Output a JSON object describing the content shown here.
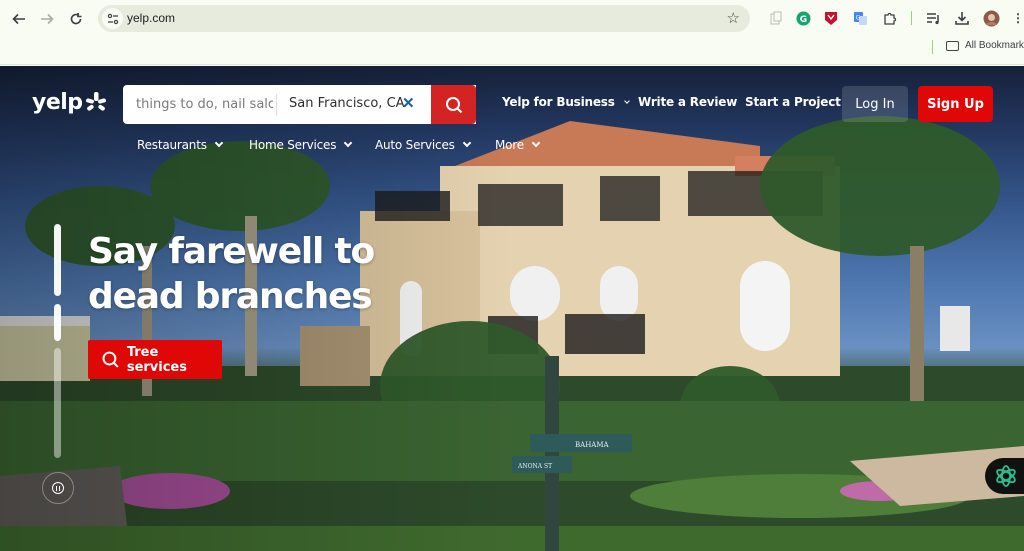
{
  "browser": {
    "url": "yelp.com",
    "bookmarks_label": "All Bookmarks",
    "extensions": [
      "clipboard-icon",
      "grammarly-icon",
      "shield-extension-icon",
      "translate-icon",
      "extensions-puzzle-icon"
    ],
    "toolbar_icons": [
      "reading-list-icon",
      "download-icon",
      "profile-avatar",
      "more-menu-icon"
    ]
  },
  "yelp": {
    "logo_text": "yelp",
    "search": {
      "what_placeholder": "things to do, nail salons, plumbers",
      "where_value": "San Francisco, CA",
      "clear_symbol": "✕"
    },
    "top_links": {
      "business": "Yelp for Business",
      "write_review": "Write a Review",
      "start_project": "Start a Project"
    },
    "login_label": "Log In",
    "signup_label": "Sign Up",
    "categories": [
      {
        "label": "Restaurants"
      },
      {
        "label": "Home Services"
      },
      {
        "label": "Auto Services"
      },
      {
        "label": "More"
      }
    ],
    "hero": {
      "headline_line1": "Say farewell to",
      "headline_line2": "dead branches",
      "cta_label": "Tree services",
      "street_sign_1": "BAHAMA",
      "street_sign_2": "ANONA ST",
      "slide_progress": 0.55
    },
    "colors": {
      "brand_red": "#d32323",
      "signup_red": "#e00707",
      "clear_blue": "#1d5fa3",
      "assistant_green": "#2bbf8f"
    }
  }
}
